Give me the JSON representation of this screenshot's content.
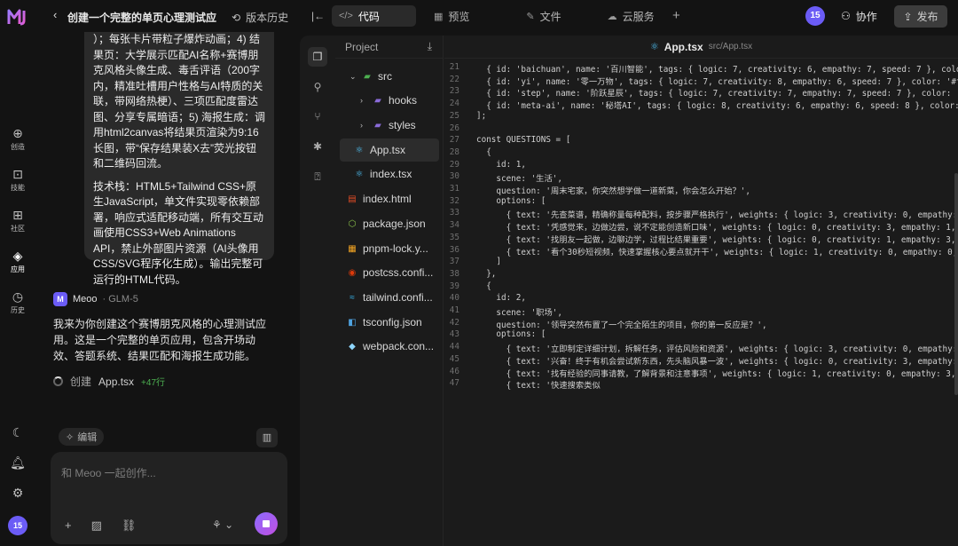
{
  "header": {
    "title": "创建一个完整的单页心理测试应",
    "version_label": "版本历史",
    "tabs": [
      {
        "label": "代码",
        "icon": "code-icon"
      },
      {
        "label": "预览",
        "icon": "preview-icon"
      },
      {
        "label": "文件",
        "icon": "file-icon"
      },
      {
        "label": "云服务",
        "icon": "cloud-icon"
      }
    ],
    "avatar": "15",
    "collab_label": "协作",
    "publish_label": "发布"
  },
  "rail": [
    {
      "label": "创造",
      "icon": "plus-circle-icon"
    },
    {
      "label": "技能",
      "icon": "skill-icon"
    },
    {
      "label": "社区",
      "icon": "grid-icon"
    },
    {
      "label": "应用",
      "icon": "cube-icon"
    },
    {
      "label": "历史",
      "icon": "clock-icon"
    }
  ],
  "rail_bottom_avatar": "15",
  "chat": {
    "bubble_p1": "）；每张卡片带粒子爆炸动画；4) 结果页：大学展示匹配AI名称+赛博朋克风格头像生成、毒舌评语（200字内，精准吐槽用户性格与AI特质的关联，带网络热梗）、三项匹配度雷达图、分享专属暗语；5) 海报生成：调用html2canvas将结果页渲染为9:16长图，带“保存结果装X去”荧光按钮和二维码回流。",
    "bubble_p2": "技术栈：HTML5+Tailwind CSS+原生JavaScript，单文件实现零依赖部署，响应式适配移动端，所有交互动画使用CSS3+Web Animations API，禁止外部图片资源（AI头像用CSS/SVG程序化生成）。输出完整可运行的HTML代码。",
    "assistant_name": "Meoo",
    "assistant_model": "· GLM-5",
    "reply": "我来为你创建这个赛博朋克风格的心理测试应用。这是一个完整的单页应用，包含开场动效、答题系统、结果匹配和海报生成功能。",
    "status_label": "创建",
    "status_file": "App.tsx",
    "status_diff": "+47行",
    "edit_label": "编辑",
    "input_placeholder": "和 Meoo 一起创作..."
  },
  "tree": {
    "title": "Project",
    "items": [
      {
        "label": "src",
        "type": "folder",
        "open": true
      },
      {
        "label": "hooks",
        "type": "folder"
      },
      {
        "label": "styles",
        "type": "folder"
      },
      {
        "label": "App.tsx",
        "type": "react",
        "selected": true
      },
      {
        "label": "index.tsx",
        "type": "react"
      },
      {
        "label": "index.html",
        "type": "html"
      },
      {
        "label": "package.json",
        "type": "json"
      },
      {
        "label": "pnpm-lock.y...",
        "type": "lock"
      },
      {
        "label": "postcss.confi...",
        "type": "postcss"
      },
      {
        "label": "tailwind.confi...",
        "type": "tailwind"
      },
      {
        "label": "tsconfig.json",
        "type": "ts"
      },
      {
        "label": "webpack.con...",
        "type": "webpack"
      }
    ]
  },
  "editor": {
    "filename": "App.tsx",
    "path": "src/App.tsx",
    "lines": [
      {
        "n": "21",
        "t": "  { id: 'baichuan', name: '百川智能', tags: { logic: 7, creativity: 6, empathy: 7, speed: 7 }, color: '#"
      },
      {
        "n": "22",
        "t": "  { id: 'yi', name: '零一万物', tags: { logic: 7, creativity: 8, empathy: 6, speed: 7 }, color: '#f"
      },
      {
        "n": "23",
        "t": "  { id: 'step', name: '阶跃星辰', tags: { logic: 7, creativity: 7, empathy: 7, speed: 7 }, color: '"
      },
      {
        "n": "24",
        "t": "  { id: 'meta-ai', name: '秘塔AI', tags: { logic: 8, creativity: 6, empathy: 6, speed: 8 }, color:"
      },
      {
        "n": "25",
        "t": "];"
      },
      {
        "n": "26",
        "t": ""
      },
      {
        "n": "27",
        "t": "const QUESTIONS = ["
      },
      {
        "n": "28",
        "t": "  {"
      },
      {
        "n": "29",
        "t": "    id: 1,"
      },
      {
        "n": "30",
        "t": "    scene: '生活',"
      },
      {
        "n": "31",
        "t": "    question: '周末宅家，你突然想学做一道新菜，你会怎么开始？',"
      },
      {
        "n": "32",
        "t": "    options: ["
      },
      {
        "n": "33",
        "t": "      { text: '先查菜谱，精确称量每种配料，按步骤严格执行', weights: { logic: 3, creativity: 0, empathy:"
      },
      {
        "n": "34",
        "t": "      { text: '凭感觉来，边做边尝，说不定能创造新口味', weights: { logic: 0, creativity: 3, empathy: 1,"
      },
      {
        "n": "35",
        "t": "      { text: '找朋友一起做，边聊边学，过程比结果重要', weights: { logic: 0, creativity: 1, empathy: 3,"
      },
      {
        "n": "36",
        "t": "      { text: '看个30秒短视频，快速掌握核心要点就开干', weights: { logic: 1, creativity: 0, empathy: 0,"
      },
      {
        "n": "37",
        "t": "    ]"
      },
      {
        "n": "38",
        "t": "  },"
      },
      {
        "n": "39",
        "t": "  {"
      },
      {
        "n": "40",
        "t": "    id: 2,"
      },
      {
        "n": "41",
        "t": "    scene: '职场',"
      },
      {
        "n": "42",
        "t": "    question: '领导突然布置了一个完全陌生的项目，你的第一反应是？',"
      },
      {
        "n": "43",
        "t": "    options: ["
      },
      {
        "n": "44",
        "t": "      { text: '立即制定详细计划，拆解任务，评估风险和资源', weights: { logic: 3, creativity: 0, empathy:"
      },
      {
        "n": "45",
        "t": "      { text: '兴奋！终于有机会尝试新东西，先头脑风暴一波', weights: { logic: 0, creativity: 3, empathy:"
      },
      {
        "n": "46",
        "t": "      { text: '找有经验的同事请教，了解背景和注意事项', weights: { logic: 1, creativity: 0, empathy: 3,"
      },
      {
        "n": "47",
        "t": "      { text: '快速搜索类似"
      }
    ]
  }
}
